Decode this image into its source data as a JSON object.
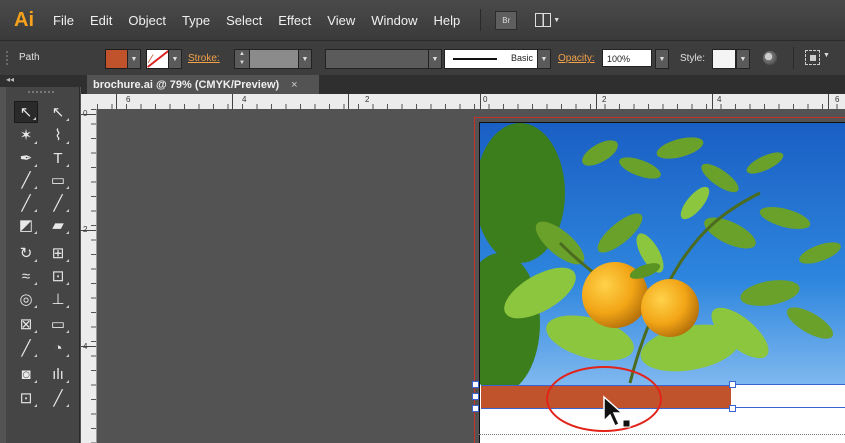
{
  "app": {
    "logo": "Ai"
  },
  "menu": [
    "File",
    "Edit",
    "Object",
    "Type",
    "Select",
    "Effect",
    "View",
    "Window",
    "Help"
  ],
  "menu_extras": {
    "bridge": "Br"
  },
  "control_bar": {
    "selection_type": "Path",
    "stroke_label": "Stroke:",
    "brush_profile": "Basic",
    "opacity_label": "Opacity:",
    "opacity_value": "100%",
    "style_label": "Style:"
  },
  "colors": {
    "fill": "#c0532b",
    "accent": "#f7a21b",
    "highlight": "#e2231a",
    "selection": "#3a62d0"
  },
  "tools_panel": {
    "collapse_glyph": "◂◂"
  },
  "tools": [
    [
      "selection-tool-icon",
      "direct-selection-tool-icon"
    ],
    [
      "magic-wand-tool-icon",
      "lasso-tool-icon"
    ],
    [
      "pen-tool-icon",
      "type-tool-icon"
    ],
    [
      "line-segment-tool-icon",
      "rectangle-tool-icon"
    ],
    [
      "paintbrush-tool-icon",
      "pencil-tool-icon"
    ],
    [
      "blob-brush-tool-icon",
      "eraser-tool-icon"
    ],
    [
      "rotate-tool-icon",
      "scale-tool-icon"
    ],
    [
      "width-tool-icon",
      "free-transform-tool-icon"
    ],
    [
      "shape-builder-tool-icon",
      "perspective-grid-tool-icon"
    ],
    [
      "mesh-tool-icon",
      "gradient-tool-icon"
    ],
    [
      "eyedropper-tool-icon",
      "blend-tool-icon"
    ],
    [
      "symbol-sprayer-tool-icon",
      "column-graph-tool-icon"
    ],
    [
      "artboard-tool-icon",
      "slice-tool-icon"
    ]
  ],
  "tool_glyphs": [
    [
      "↖",
      "↖"
    ],
    [
      "✶",
      "⌇"
    ],
    [
      "✒",
      "T"
    ],
    [
      "╱",
      "▭"
    ],
    [
      "╱",
      "╱"
    ],
    [
      "◩",
      "▰"
    ],
    [
      "↻",
      "⊞"
    ],
    [
      "≈",
      "⊡"
    ],
    [
      "◎",
      "⊥"
    ],
    [
      "⊠",
      "▭"
    ],
    [
      "╱",
      "◔"
    ],
    [
      "◙",
      "ılı"
    ],
    [
      "⊡",
      "╱"
    ]
  ],
  "document": {
    "tab_title": "brochure.ai @ 79% (CMYK/Preview)",
    "close_glyph": "×"
  },
  "ruler": {
    "horizontal_labels": [
      "6",
      "4",
      "2",
      "0",
      "2",
      "4",
      "6"
    ],
    "vertical_labels": [
      "0",
      "2",
      "4"
    ]
  }
}
